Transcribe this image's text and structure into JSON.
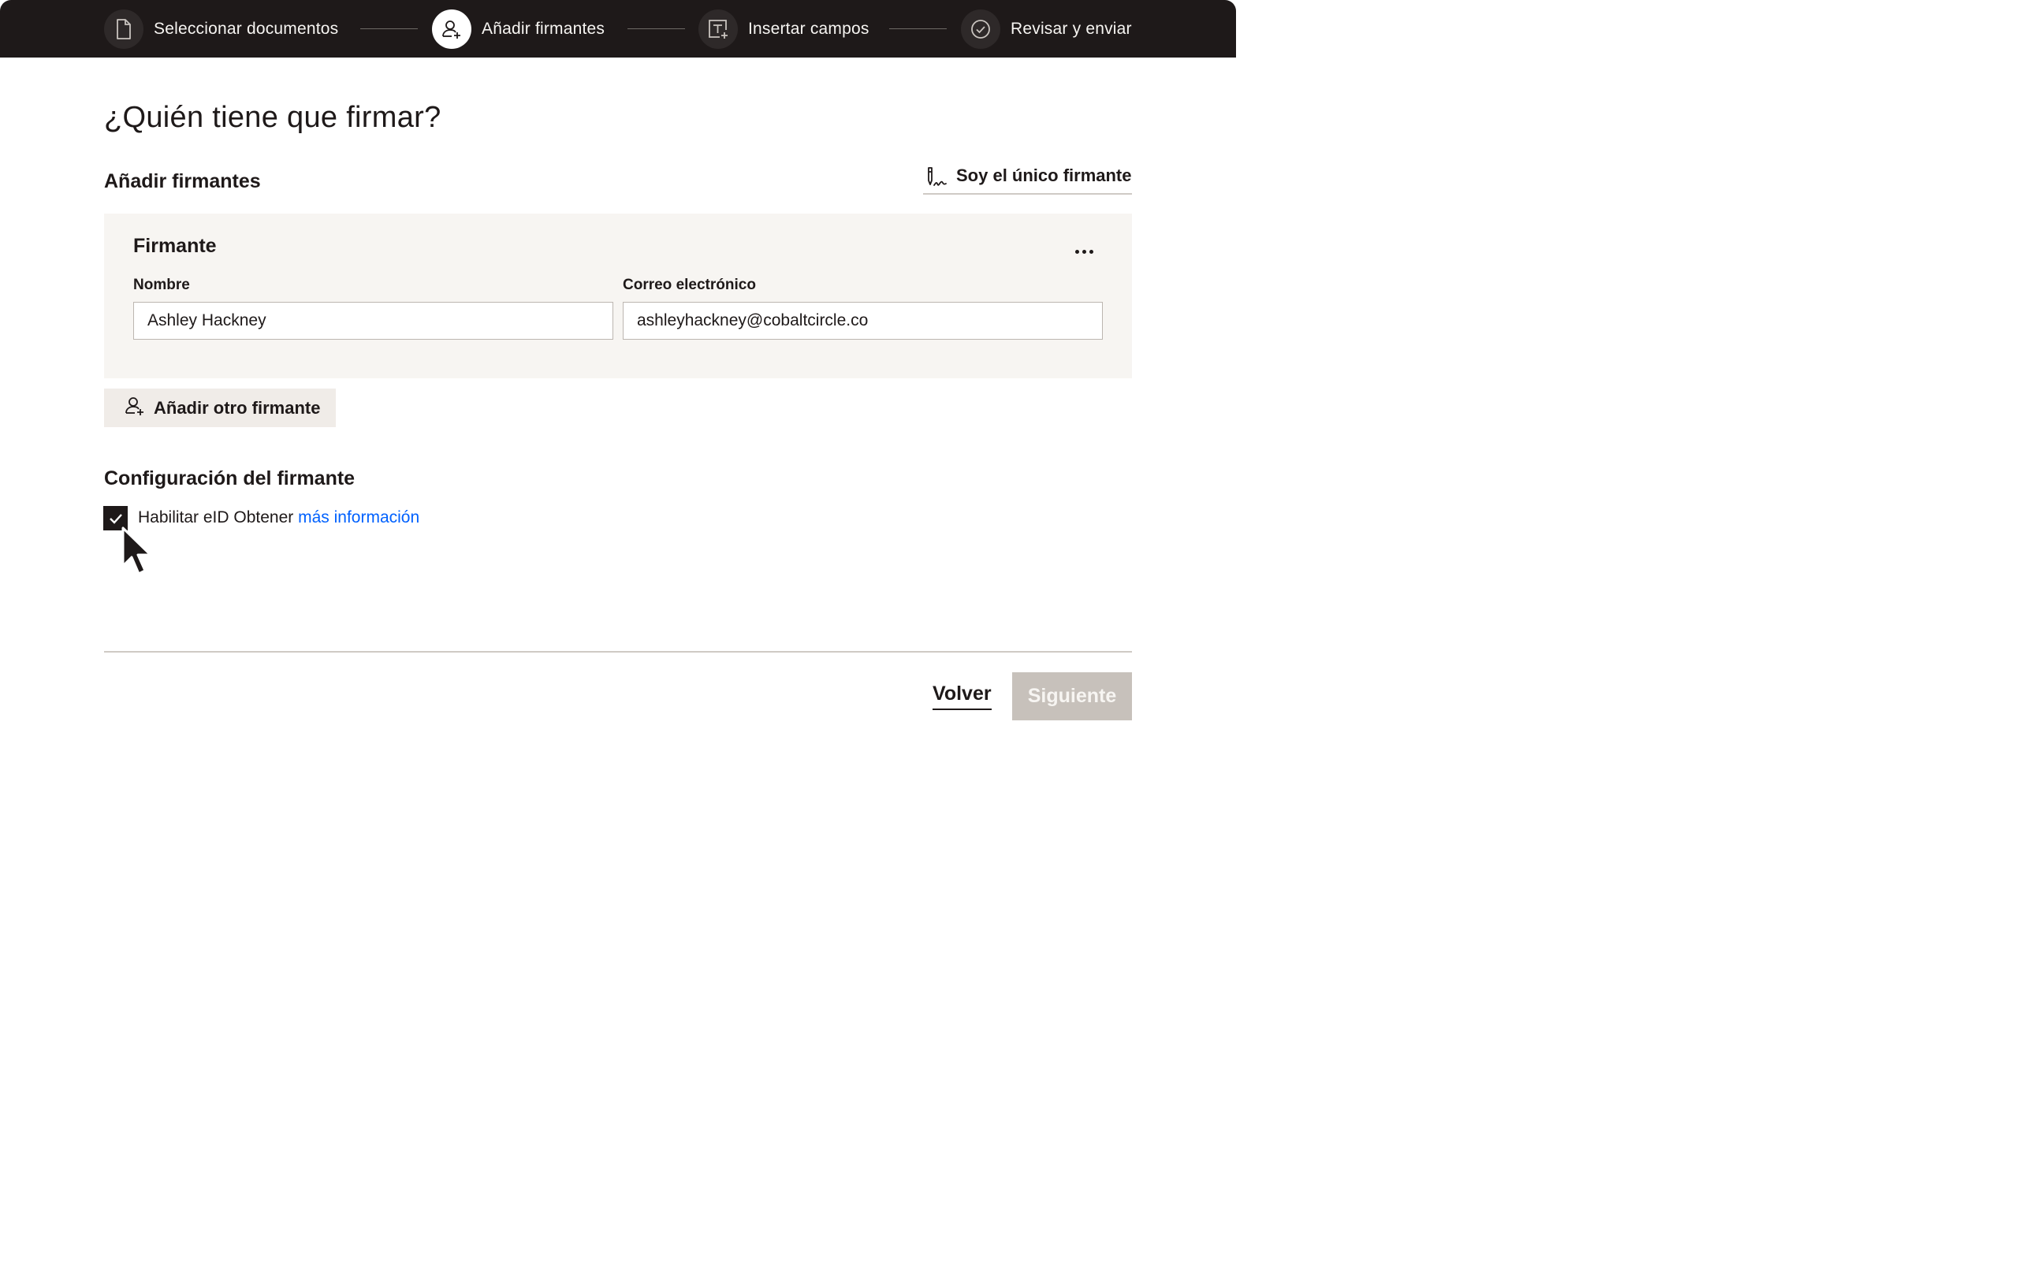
{
  "stepper": {
    "steps": [
      {
        "label": "Seleccionar documentos",
        "icon": "document-icon",
        "active": false
      },
      {
        "label": "Añadir firmantes",
        "icon": "add-person-icon",
        "active": true
      },
      {
        "label": "Insertar campos",
        "icon": "insert-field-icon",
        "active": false
      },
      {
        "label": "Revisar y enviar",
        "icon": "check-circle-icon",
        "active": false
      }
    ]
  },
  "page": {
    "title": "¿Quién tiene que firmar?",
    "section_title": "Añadir firmantes",
    "only_signer_label": "Soy el único firmante"
  },
  "signer_card": {
    "title": "Firmante",
    "name_label": "Nombre",
    "name_value": "Ashley Hackney",
    "email_label": "Correo electrónico",
    "email_value": "ashleyhackney@cobaltcircle.co"
  },
  "add_signer_button": "Añadir otro firmante",
  "settings": {
    "title": "Configuración del firmante",
    "eid_checked": true,
    "eid_label": "Habilitar eID Obtener",
    "more_info_link": "más información"
  },
  "footer": {
    "back_label": "Volver",
    "next_label": "Siguiente",
    "next_enabled": false
  },
  "colors": {
    "topbar": "#1e1919",
    "card": "#f7f5f2",
    "link": "#0061fe",
    "disabled_button": "#c7c1bb"
  }
}
